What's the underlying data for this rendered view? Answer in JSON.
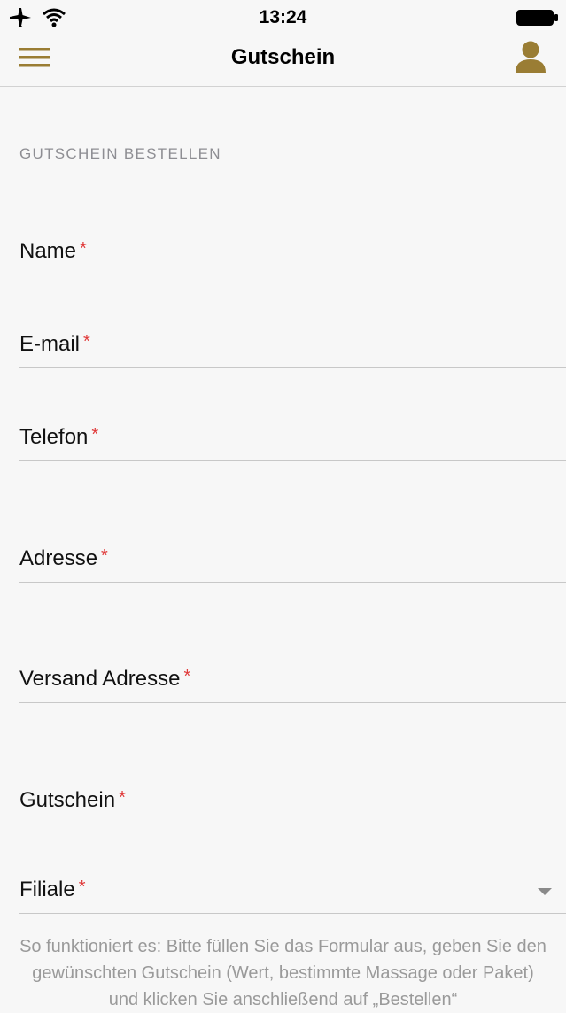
{
  "status_bar": {
    "time": "13:24",
    "icons": [
      "airplane-icon",
      "wifi-icon",
      "battery-icon"
    ]
  },
  "nav": {
    "title": "Gutschein",
    "left_icon": "hamburger-menu-icon",
    "right_icon": "user-icon",
    "accent_color": "#9a7d34"
  },
  "section": {
    "title": "GUTSCHEIN BESTELLEN"
  },
  "form": {
    "required_marker": "*",
    "fields": [
      {
        "label": "Name"
      },
      {
        "label": "E-mail"
      },
      {
        "label": "Telefon"
      },
      {
        "label": "Adresse"
      },
      {
        "label": "Versand Adresse"
      },
      {
        "label": "Gutschein"
      },
      {
        "label": "Filiale"
      }
    ]
  },
  "info": {
    "text": "So funktioniert es: Bitte füllen Sie das Formular aus, geben Sie den gewünschten Gutschein (Wert, bestimmte Massage oder Paket) und klicken Sie anschließend auf „Bestellen“"
  }
}
